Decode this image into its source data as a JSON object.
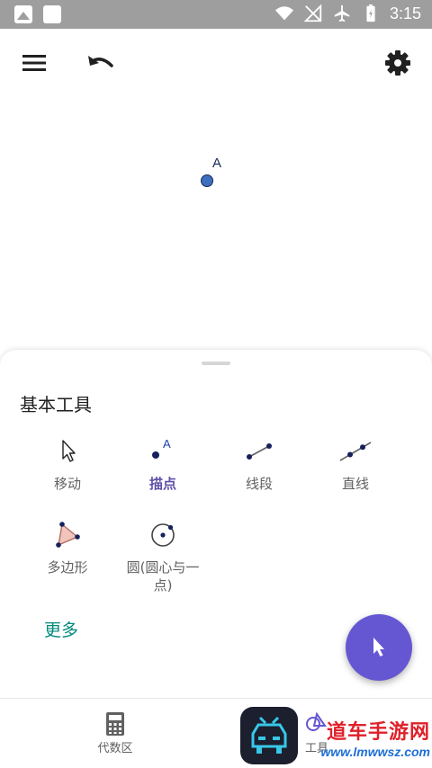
{
  "status_bar": {
    "time": "3:15"
  },
  "toolbar": {
    "menu_icon": "menu-icon",
    "undo_icon": "undo-icon",
    "settings_icon": "settings-gear-icon"
  },
  "canvas": {
    "point_label": "A"
  },
  "sheet": {
    "title": "基本工具",
    "tools": [
      {
        "label": "移动",
        "icon": "move-arrow-icon"
      },
      {
        "label": "描点",
        "icon": "point-icon",
        "active": true
      },
      {
        "label": "线段",
        "icon": "segment-icon"
      },
      {
        "label": "直线",
        "icon": "line-icon"
      },
      {
        "label": "多边形",
        "icon": "polygon-icon"
      },
      {
        "label": "圆(圆心与一点)",
        "icon": "circle-icon"
      }
    ],
    "more": "更多"
  },
  "bottom_nav": {
    "algebra": "代数区",
    "tools": "工具"
  },
  "watermark": {
    "main": "道车手游网",
    "url": "www.lmwwsz.com"
  },
  "colors": {
    "accent": "#6557d2",
    "link": "#00897b",
    "point": "#3d6fbd"
  }
}
